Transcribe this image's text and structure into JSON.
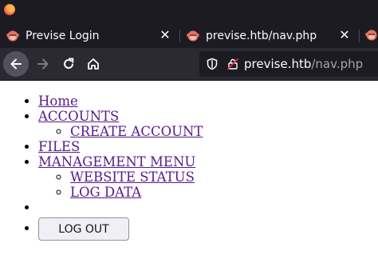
{
  "browser": {
    "tabs": [
      {
        "label": "Previse Login",
        "active": false
      },
      {
        "label": "previse.htb/nav.php",
        "active": true
      }
    ],
    "url": {
      "host": "previse.htb",
      "path": "/nav.php"
    },
    "colors": {
      "chrome_dark": "#1c1b22",
      "toolbar": "#2b2a33",
      "text": "#fbfbfe",
      "dim": "#a4a4ab"
    }
  },
  "nav": {
    "home": "Home",
    "accounts": "ACCOUNTS",
    "create_account": "CREATE ACCOUNT",
    "files": "FILES",
    "management_menu": "MANAGEMENT MENU",
    "website_status": "WEBSITE STATUS",
    "log_data": "LOG DATA",
    "logout": "LOG OUT"
  },
  "colors": {
    "link": "#551a8b",
    "button_bg": "#f0f0f4"
  }
}
